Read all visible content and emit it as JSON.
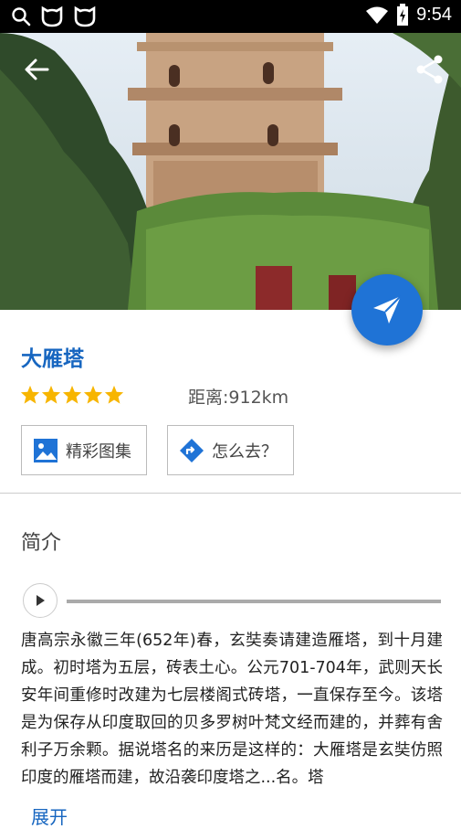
{
  "status_bar": {
    "time": "9:54",
    "icons": [
      "search-icon",
      "cat-app-icon",
      "cat-app-icon",
      "wifi-icon",
      "battery-icon"
    ]
  },
  "header": {
    "back_icon": "arrow-back-icon",
    "share_icon": "share-icon"
  },
  "fab": {
    "icon": "navigation-send-icon",
    "color": "#1f73d6"
  },
  "place": {
    "name": "大雁塔",
    "rating": 5,
    "rating_max": 5,
    "distance": "距离:912km"
  },
  "actions": {
    "gallery_label": "精彩图集",
    "route_label": "怎么去？"
  },
  "intro": {
    "title": "简介",
    "audio_progress": 0,
    "text": "唐高宗永徽三年(652年)春，玄奘奏请建造雁塔，到十月建成。初时塔为五层，砖表土心。公元701-704年，武则天长安年间重修时改建为七层楼阁式砖塔，一直保存至今。该塔是为保存从印度取回的贝多罗树叶梵文经而建的，并葬有舍利子万余颗。据说塔名的来历是这样的：大雁塔是玄奘仿照印度的雁塔而建，故沿袭印度塔之...名。塔",
    "expand_label": "展开"
  },
  "colors": {
    "accent": "#1766c0",
    "star": "#f7b500",
    "status_bar": "#000000"
  }
}
